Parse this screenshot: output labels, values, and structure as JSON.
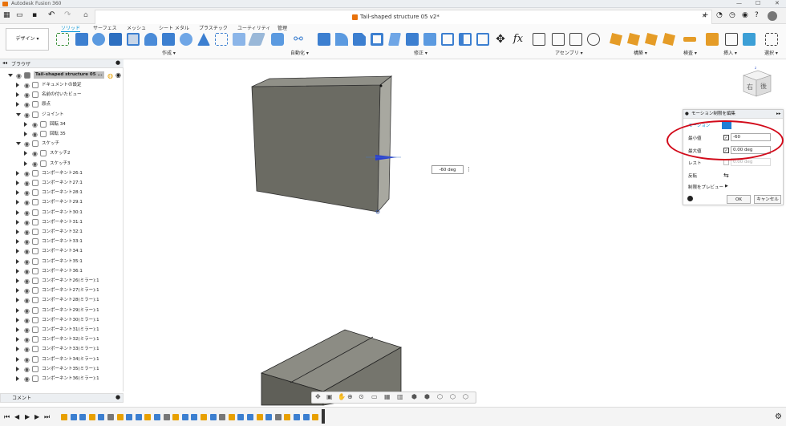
{
  "app": {
    "title": "Autodesk Fusion 360"
  },
  "document": {
    "name": "Tail-shaped structure 05 v2*"
  },
  "workspace": {
    "label": "デザイン ▾"
  },
  "toolbar": {
    "tabs": [
      "ソリッド",
      "サーフェス",
      "メッシュ",
      "シート メタル",
      "プラスチック",
      "ユーティリティ",
      "管理"
    ],
    "active_tab": "ソリッド",
    "groups": [
      "作成 ▾",
      "自動化 ▾",
      "修正 ▾",
      "アセンブリ ▾",
      "構築 ▾",
      "検査 ▾",
      "挿入 ▾",
      "選択 ▾"
    ]
  },
  "browser": {
    "title": "ブラウザ",
    "root": "Tail-shaped structure 05 ...",
    "items": [
      {
        "label": "ドキュメントの設定",
        "indent": 1,
        "open": false
      },
      {
        "label": "名前の付いたビュー",
        "indent": 1,
        "open": false
      },
      {
        "label": "原点",
        "indent": 1,
        "open": false
      },
      {
        "label": "ジョイント",
        "indent": 1,
        "open": true
      },
      {
        "label": "回転 34",
        "indent": 2,
        "open": false
      },
      {
        "label": "回転 35",
        "indent": 2,
        "open": false
      },
      {
        "label": "スケッチ",
        "indent": 1,
        "open": true
      },
      {
        "label": "スケッチ2",
        "indent": 2,
        "open": false
      },
      {
        "label": "スケッチ3",
        "indent": 2,
        "open": false
      },
      {
        "label": "コンポーネント26:1",
        "indent": 1,
        "open": false
      },
      {
        "label": "コンポーネント27:1",
        "indent": 1,
        "open": false
      },
      {
        "label": "コンポーネント28:1",
        "indent": 1,
        "open": false
      },
      {
        "label": "コンポーネント29:1",
        "indent": 1,
        "open": false
      },
      {
        "label": "コンポーネント30:1",
        "indent": 1,
        "open": false
      },
      {
        "label": "コンポーネント31:1",
        "indent": 1,
        "open": false
      },
      {
        "label": "コンポーネント32:1",
        "indent": 1,
        "open": false
      },
      {
        "label": "コンポーネント33:1",
        "indent": 1,
        "open": false
      },
      {
        "label": "コンポーネント34:1",
        "indent": 1,
        "open": false
      },
      {
        "label": "コンポーネント35:1",
        "indent": 1,
        "open": false
      },
      {
        "label": "コンポーネント36:1",
        "indent": 1,
        "open": false
      },
      {
        "label": "コンポーネント26(ミラー):1",
        "indent": 1,
        "open": false
      },
      {
        "label": "コンポーネント27(ミラー):1",
        "indent": 1,
        "open": false
      },
      {
        "label": "コンポーネント28(ミラー):1",
        "indent": 1,
        "open": false
      },
      {
        "label": "コンポーネント29(ミラー):1",
        "indent": 1,
        "open": false
      },
      {
        "label": "コンポーネント30(ミラー):1",
        "indent": 1,
        "open": false
      },
      {
        "label": "コンポーネント31(ミラー):1",
        "indent": 1,
        "open": false
      },
      {
        "label": "コンポーネント32(ミラー):1",
        "indent": 1,
        "open": false
      },
      {
        "label": "コンポーネント33(ミラー):1",
        "indent": 1,
        "open": false
      },
      {
        "label": "コンポーネント34(ミラー):1",
        "indent": 1,
        "open": false
      },
      {
        "label": "コンポーネント35(ミラー):1",
        "indent": 1,
        "open": false
      },
      {
        "label": "コンポーネント36(ミラー):1",
        "indent": 1,
        "open": false
      }
    ]
  },
  "comment": {
    "label": "コメント"
  },
  "viewport": {
    "angle_value": "-60 deg"
  },
  "viewcube": {
    "right": "右",
    "back": "後"
  },
  "panel": {
    "title": "モーション制限を編集",
    "motion_label": "モーション",
    "min_label": "最小値",
    "min_value": "-60",
    "max_label": "最大値",
    "max_value": "0.00 deg",
    "rest_label": "レスト",
    "rest_value": "0.00 deg",
    "flip_label": "反転",
    "preview_label": "制限をプレビュー",
    "ok": "OK",
    "cancel": "キャンセル"
  },
  "colors": {
    "accent": "#0696d7",
    "annotation": "#d20a1a",
    "model": "#6b6b63"
  }
}
